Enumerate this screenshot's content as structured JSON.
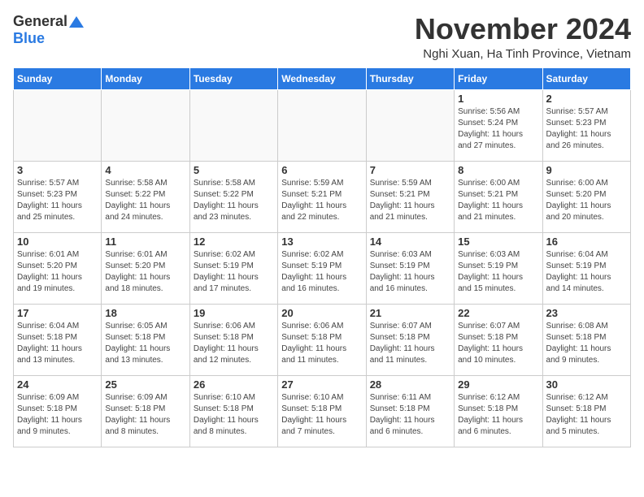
{
  "logo": {
    "general": "General",
    "blue": "Blue"
  },
  "title": "November 2024",
  "subtitle": "Nghi Xuan, Ha Tinh Province, Vietnam",
  "weekdays": [
    "Sunday",
    "Monday",
    "Tuesday",
    "Wednesday",
    "Thursday",
    "Friday",
    "Saturday"
  ],
  "weeks": [
    [
      {
        "day": "",
        "info": ""
      },
      {
        "day": "",
        "info": ""
      },
      {
        "day": "",
        "info": ""
      },
      {
        "day": "",
        "info": ""
      },
      {
        "day": "",
        "info": ""
      },
      {
        "day": "1",
        "info": "Sunrise: 5:56 AM\nSunset: 5:24 PM\nDaylight: 11 hours\nand 27 minutes."
      },
      {
        "day": "2",
        "info": "Sunrise: 5:57 AM\nSunset: 5:23 PM\nDaylight: 11 hours\nand 26 minutes."
      }
    ],
    [
      {
        "day": "3",
        "info": "Sunrise: 5:57 AM\nSunset: 5:23 PM\nDaylight: 11 hours\nand 25 minutes."
      },
      {
        "day": "4",
        "info": "Sunrise: 5:58 AM\nSunset: 5:22 PM\nDaylight: 11 hours\nand 24 minutes."
      },
      {
        "day": "5",
        "info": "Sunrise: 5:58 AM\nSunset: 5:22 PM\nDaylight: 11 hours\nand 23 minutes."
      },
      {
        "day": "6",
        "info": "Sunrise: 5:59 AM\nSunset: 5:21 PM\nDaylight: 11 hours\nand 22 minutes."
      },
      {
        "day": "7",
        "info": "Sunrise: 5:59 AM\nSunset: 5:21 PM\nDaylight: 11 hours\nand 21 minutes."
      },
      {
        "day": "8",
        "info": "Sunrise: 6:00 AM\nSunset: 5:21 PM\nDaylight: 11 hours\nand 21 minutes."
      },
      {
        "day": "9",
        "info": "Sunrise: 6:00 AM\nSunset: 5:20 PM\nDaylight: 11 hours\nand 20 minutes."
      }
    ],
    [
      {
        "day": "10",
        "info": "Sunrise: 6:01 AM\nSunset: 5:20 PM\nDaylight: 11 hours\nand 19 minutes."
      },
      {
        "day": "11",
        "info": "Sunrise: 6:01 AM\nSunset: 5:20 PM\nDaylight: 11 hours\nand 18 minutes."
      },
      {
        "day": "12",
        "info": "Sunrise: 6:02 AM\nSunset: 5:19 PM\nDaylight: 11 hours\nand 17 minutes."
      },
      {
        "day": "13",
        "info": "Sunrise: 6:02 AM\nSunset: 5:19 PM\nDaylight: 11 hours\nand 16 minutes."
      },
      {
        "day": "14",
        "info": "Sunrise: 6:03 AM\nSunset: 5:19 PM\nDaylight: 11 hours\nand 16 minutes."
      },
      {
        "day": "15",
        "info": "Sunrise: 6:03 AM\nSunset: 5:19 PM\nDaylight: 11 hours\nand 15 minutes."
      },
      {
        "day": "16",
        "info": "Sunrise: 6:04 AM\nSunset: 5:19 PM\nDaylight: 11 hours\nand 14 minutes."
      }
    ],
    [
      {
        "day": "17",
        "info": "Sunrise: 6:04 AM\nSunset: 5:18 PM\nDaylight: 11 hours\nand 13 minutes."
      },
      {
        "day": "18",
        "info": "Sunrise: 6:05 AM\nSunset: 5:18 PM\nDaylight: 11 hours\nand 13 minutes."
      },
      {
        "day": "19",
        "info": "Sunrise: 6:06 AM\nSunset: 5:18 PM\nDaylight: 11 hours\nand 12 minutes."
      },
      {
        "day": "20",
        "info": "Sunrise: 6:06 AM\nSunset: 5:18 PM\nDaylight: 11 hours\nand 11 minutes."
      },
      {
        "day": "21",
        "info": "Sunrise: 6:07 AM\nSunset: 5:18 PM\nDaylight: 11 hours\nand 11 minutes."
      },
      {
        "day": "22",
        "info": "Sunrise: 6:07 AM\nSunset: 5:18 PM\nDaylight: 11 hours\nand 10 minutes."
      },
      {
        "day": "23",
        "info": "Sunrise: 6:08 AM\nSunset: 5:18 PM\nDaylight: 11 hours\nand 9 minutes."
      }
    ],
    [
      {
        "day": "24",
        "info": "Sunrise: 6:09 AM\nSunset: 5:18 PM\nDaylight: 11 hours\nand 9 minutes."
      },
      {
        "day": "25",
        "info": "Sunrise: 6:09 AM\nSunset: 5:18 PM\nDaylight: 11 hours\nand 8 minutes."
      },
      {
        "day": "26",
        "info": "Sunrise: 6:10 AM\nSunset: 5:18 PM\nDaylight: 11 hours\nand 8 minutes."
      },
      {
        "day": "27",
        "info": "Sunrise: 6:10 AM\nSunset: 5:18 PM\nDaylight: 11 hours\nand 7 minutes."
      },
      {
        "day": "28",
        "info": "Sunrise: 6:11 AM\nSunset: 5:18 PM\nDaylight: 11 hours\nand 6 minutes."
      },
      {
        "day": "29",
        "info": "Sunrise: 6:12 AM\nSunset: 5:18 PM\nDaylight: 11 hours\nand 6 minutes."
      },
      {
        "day": "30",
        "info": "Sunrise: 6:12 AM\nSunset: 5:18 PM\nDaylight: 11 hours\nand 5 minutes."
      }
    ]
  ]
}
